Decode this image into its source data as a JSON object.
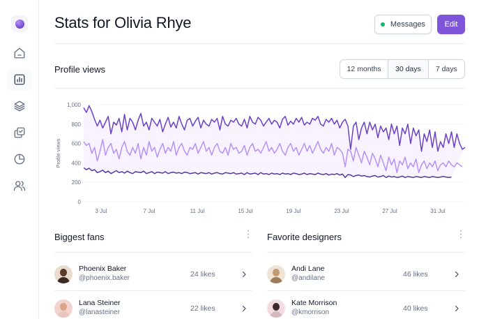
{
  "header": {
    "title": "Stats for Olivia Rhye",
    "messages_label": "Messages",
    "edit_label": "Edit"
  },
  "sidebar": {
    "items": [
      {
        "name": "home",
        "icon": "home-icon",
        "active": false
      },
      {
        "name": "stats",
        "icon": "bar-chart-icon",
        "active": true
      },
      {
        "name": "layers",
        "icon": "layers-icon",
        "active": false
      },
      {
        "name": "tasks",
        "icon": "check-squares-icon",
        "active": false
      },
      {
        "name": "reports",
        "icon": "pie-chart-icon",
        "active": false
      },
      {
        "name": "users",
        "icon": "users-icon",
        "active": false
      }
    ]
  },
  "profile_views": {
    "title": "Profile views",
    "ranges": [
      "12 months",
      "30 days",
      "7 days"
    ],
    "active_range": "30 days"
  },
  "chart_data": {
    "type": "line",
    "ylabel": "Profile views",
    "xlabel": "",
    "ylim": [
      0,
      1000
    ],
    "yticks": [
      0,
      200,
      400,
      600,
      800,
      "1,000"
    ],
    "xticks": [
      "3 Jul",
      "7 Jul",
      "11 Jul",
      "15 Jul",
      "19 Jul",
      "23 Jul",
      "27 Jul",
      "31 Jul"
    ],
    "fill_between_top_and_bottom": true,
    "colors": {
      "top": "#6941c6",
      "middle": "#b692f6",
      "bottom": "#53389e",
      "fill": "#f4ebff"
    },
    "series": [
      {
        "values": [
          970,
          920,
          990,
          930,
          850,
          780,
          840,
          760,
          820,
          880,
          700,
          820,
          790,
          860,
          720,
          900,
          740,
          860,
          820,
          740,
          840,
          910,
          780,
          820,
          740,
          860,
          820,
          780,
          850,
          720,
          800,
          870,
          770,
          820,
          760,
          880,
          800,
          740,
          840,
          860,
          780,
          830,
          870,
          760,
          840,
          800,
          780,
          850,
          820,
          860,
          740,
          880,
          800,
          780,
          840,
          820,
          860,
          800,
          780,
          850,
          760,
          880,
          820,
          800,
          870,
          840,
          780,
          820,
          860,
          800,
          840,
          820,
          760,
          850,
          880,
          790,
          830,
          800,
          860,
          820,
          870,
          790,
          820,
          800,
          860,
          840,
          880,
          800,
          780,
          850,
          820,
          860,
          800,
          840,
          760,
          820,
          850,
          780,
          540,
          780,
          820,
          640,
          760,
          820,
          700,
          820,
          740,
          800,
          660,
          780,
          720,
          760,
          640,
          800,
          700,
          780,
          580,
          760,
          700,
          800,
          600,
          760,
          680,
          740,
          520,
          700,
          620,
          740,
          560,
          720,
          520,
          620,
          560,
          700,
          600,
          720,
          560,
          700,
          600,
          540,
          560
        ]
      },
      {
        "values": [
          620,
          580,
          600,
          500,
          560,
          420,
          520,
          640,
          480,
          560,
          600,
          500,
          540,
          440,
          560,
          620,
          520,
          480,
          560,
          500,
          600,
          440,
          560,
          480,
          620,
          520,
          560,
          460,
          540,
          600,
          500,
          560,
          520,
          620,
          480,
          560,
          600,
          520,
          480,
          560,
          540,
          600,
          500,
          560,
          620,
          520,
          560,
          480,
          560,
          600,
          520,
          500,
          560,
          480,
          600,
          540,
          560,
          500,
          520,
          580,
          480,
          560,
          600,
          520,
          540,
          500,
          560,
          620,
          520,
          560,
          500,
          540,
          600,
          520,
          480,
          560,
          600,
          520,
          560,
          480,
          540,
          600,
          520,
          580,
          500,
          560,
          620,
          540,
          500,
          560,
          520,
          600,
          480,
          560,
          540,
          500,
          360,
          540,
          520,
          420,
          560,
          480,
          400,
          520,
          460,
          380,
          500,
          440,
          360,
          480,
          400,
          320,
          460,
          380,
          440,
          300,
          420,
          380,
          460,
          340,
          400,
          360,
          440,
          300,
          380,
          420,
          340,
          400,
          360,
          420,
          320,
          380,
          400,
          360,
          420,
          380,
          360,
          400,
          380,
          360
        ]
      },
      {
        "values": [
          350,
          330,
          345,
          320,
          330,
          300,
          310,
          325,
          300,
          315,
          290,
          305,
          320,
          300,
          310,
          295,
          315,
          300,
          290,
          310,
          305,
          300,
          315,
          290,
          300,
          310,
          290,
          305,
          300,
          295,
          310,
          290,
          300,
          305,
          295,
          300,
          290,
          305,
          300,
          290,
          295,
          300,
          285,
          300,
          295,
          290,
          300,
          285,
          295,
          300,
          290,
          285,
          300,
          295,
          290,
          300,
          285,
          290,
          295,
          280,
          300,
          285,
          290,
          295,
          280,
          300,
          285,
          290,
          280,
          295,
          285,
          290,
          280,
          295,
          285,
          290,
          280,
          295,
          290,
          280,
          285,
          295,
          280,
          290,
          285,
          280,
          295,
          285,
          280,
          290,
          275,
          285,
          280,
          290,
          275,
          285,
          250,
          280,
          275,
          260,
          270,
          275,
          265,
          270,
          260,
          255,
          265,
          270,
          255,
          260,
          270,
          250,
          265,
          255,
          260,
          250,
          255,
          265,
          250,
          260,
          255,
          250,
          260,
          255,
          250,
          260,
          255,
          250,
          260,
          255,
          250,
          255,
          260,
          255,
          250,
          255
        ]
      }
    ]
  },
  "biggest_fans": {
    "title": "Biggest fans",
    "items": [
      {
        "name": "Phoenix Baker",
        "handle": "@phoenix.baker",
        "likes": "24 likes"
      },
      {
        "name": "Lana Steiner",
        "handle": "@lanasteiner",
        "likes": "22 likes"
      }
    ]
  },
  "favorite_designers": {
    "title": "Favorite designers",
    "items": [
      {
        "name": "Andi Lane",
        "handle": "@andilane",
        "likes": "46 likes"
      },
      {
        "name": "Kate Morrison",
        "handle": "@kmorrison",
        "likes": "40 likes"
      }
    ]
  }
}
